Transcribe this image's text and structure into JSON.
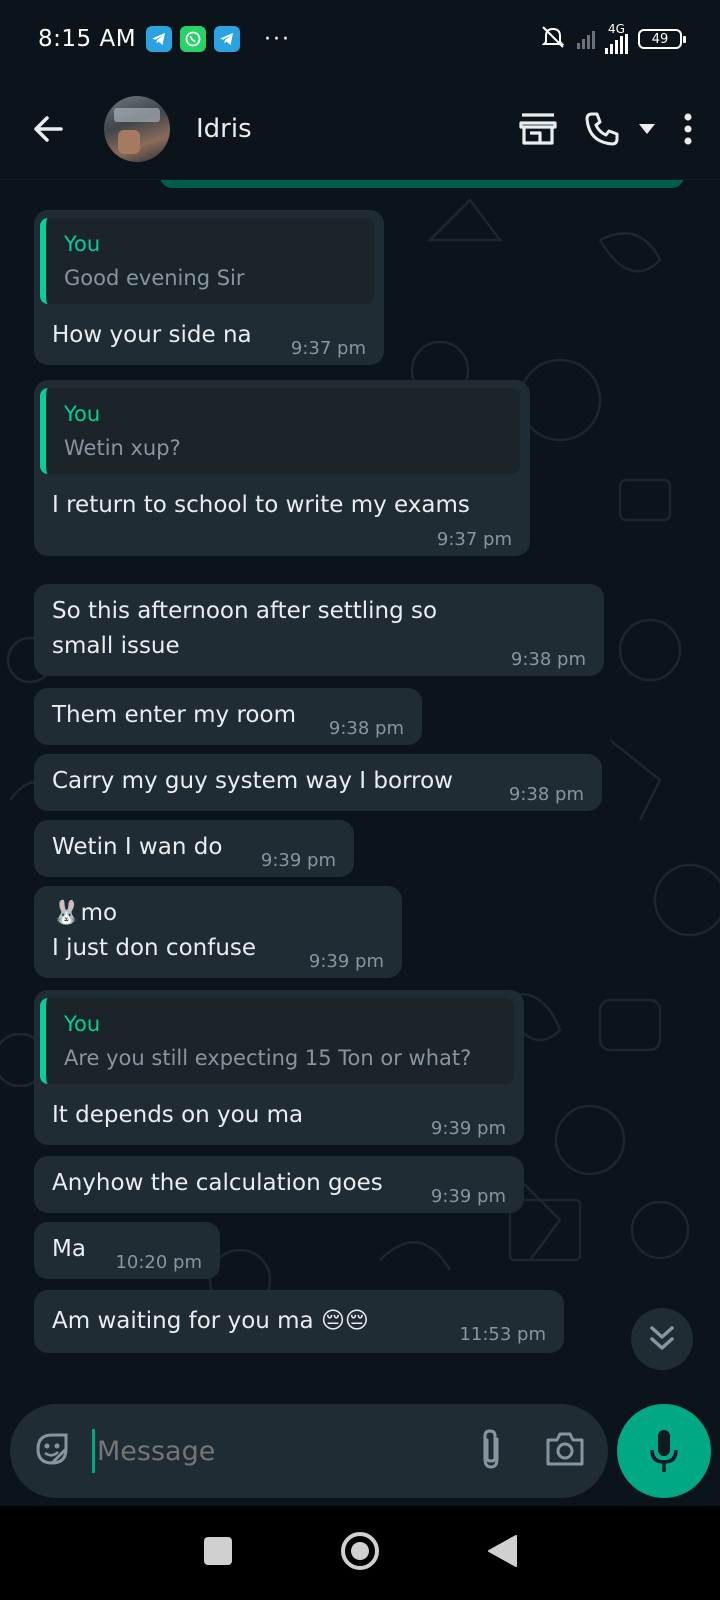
{
  "status_bar": {
    "time": "8:15 AM",
    "more": "···",
    "network_label": "4G",
    "battery_level": "49",
    "icons": [
      "telegram-icon",
      "whatsapp-icon",
      "telegram-icon",
      "mute-icon",
      "signal-icon",
      "battery-icon"
    ]
  },
  "header": {
    "contact_name": "Idris",
    "icons": [
      "back-arrow-icon",
      "store-icon",
      "phone-icon",
      "caret-down-icon",
      "more-vert-icon"
    ]
  },
  "messages": [
    {
      "quote_author": "You",
      "quote_text": "Good evening Sir",
      "text": "How your side na",
      "time": "9:37 pm"
    },
    {
      "quote_author": "You",
      "quote_text": "Wetin xup?",
      "text": "I return to school to write my exams",
      "time": "9:37 pm"
    },
    {
      "text": "So this afternoon after settling so small issue",
      "time": "9:38 pm"
    },
    {
      "text": "Them enter my room",
      "time": "9:38 pm"
    },
    {
      "text": "Carry my guy system way I borrow",
      "time": "9:38 pm"
    },
    {
      "text": "Wetin I wan do",
      "time": "9:39 pm"
    },
    {
      "text": "🐰mo",
      "text2": "I just don confuse",
      "time": "9:39 pm"
    },
    {
      "quote_author": "You",
      "quote_text": "Are you still expecting 15 Ton or what?",
      "text": "It depends on you ma",
      "time": "9:39 pm"
    },
    {
      "text": "Anyhow the calculation goes",
      "time": "9:39 pm"
    },
    {
      "text": "Ma",
      "time": "10:20 pm"
    },
    {
      "text": "Am waiting for you ma 😔😔",
      "time": "11:53 pm"
    }
  ],
  "input": {
    "placeholder": "Message",
    "icons": [
      "sticker-icon",
      "attach-icon",
      "camera-icon",
      "mic-icon"
    ]
  },
  "colors": {
    "background": "#0b141a",
    "bubble": "#202c33",
    "accent": "#00a884",
    "quote_accent": "#06cf9c",
    "muted_text": "#8696a0"
  }
}
